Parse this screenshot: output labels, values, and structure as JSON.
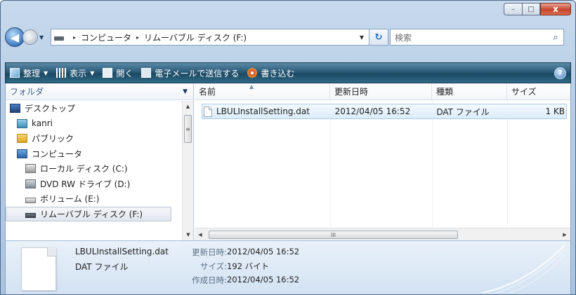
{
  "window": {
    "caption_buttons": {
      "minimize": "–",
      "maximize": "□",
      "close": "x"
    }
  },
  "address_bar": {
    "back_glyph": "◀",
    "forward_glyph": "▶",
    "crumbs": [
      "コンピュータ",
      "リムーバブル ディスク (F:)"
    ],
    "crumb_separator": "▸",
    "dropdown_glyph": "▼",
    "refresh_glyph": "↻"
  },
  "search": {
    "placeholder": "検索",
    "icon": "search-icon",
    "glyph": "⌕"
  },
  "command_bar": {
    "organize": "整理",
    "views": "表示",
    "open": "開く",
    "email": "電子メールで送信する",
    "burn": "書き込む",
    "help_glyph": "?"
  },
  "folder_pane": {
    "header": "フォルダ",
    "items": [
      {
        "label": "デスクトップ",
        "icon": "desktop-icon"
      },
      {
        "label": "kanri",
        "icon": "user-folder-icon"
      },
      {
        "label": "パブリック",
        "icon": "public-folder-icon"
      },
      {
        "label": "コンピュータ",
        "icon": "computer-icon"
      },
      {
        "label": "ローカル ディスク (C:)",
        "icon": "local-disk-icon"
      },
      {
        "label": "DVD RW ドライブ (D:)",
        "icon": "dvd-drive-icon"
      },
      {
        "label": "ボリューム (E:)",
        "icon": "volume-icon"
      },
      {
        "label": "リムーバブル ディスク (F:)",
        "icon": "removable-disk-icon",
        "selected": true
      }
    ]
  },
  "file_list": {
    "columns": {
      "name": "名前",
      "date": "更新日時",
      "type": "種類",
      "size": "サイズ"
    },
    "rows": [
      {
        "name": "LBULInstallSetting.dat",
        "date": "2012/04/05 16:52",
        "type": "DAT ファイル",
        "size": "1 KB"
      }
    ],
    "scroll_thumb_glyph": "III"
  },
  "details_pane": {
    "name": "LBULInstallSetting.dat",
    "type": "DAT ファイル",
    "properties": [
      {
        "label": "更新日時:",
        "value": "2012/04/05 16:52"
      },
      {
        "label": "サイズ:",
        "value": "192 バイト"
      },
      {
        "label": "作成日時:",
        "value": "2012/04/05 16:52"
      }
    ]
  },
  "colors": {
    "command_bar": "#1c4a64",
    "selection": "#dcecfa",
    "close_button": "#c5452c"
  }
}
